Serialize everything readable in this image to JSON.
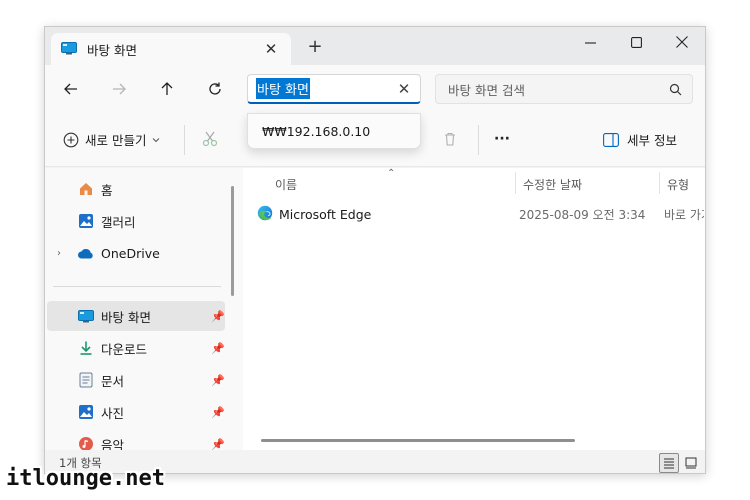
{
  "window": {
    "tab_title": "바탕 화면",
    "new_tab": "+"
  },
  "address": {
    "value": "바탕 화면",
    "suggestion": "₩₩192.168.0.10"
  },
  "search": {
    "placeholder": "바탕 화면 검색"
  },
  "toolbar": {
    "new_label": "새로 만들기",
    "more_label": "···",
    "details_label": "세부 정보"
  },
  "sidebar": {
    "items": [
      {
        "label": "홈",
        "icon": "home-icon"
      },
      {
        "label": "갤러리",
        "icon": "gallery-icon"
      },
      {
        "label": "OneDrive",
        "icon": "cloud-icon"
      },
      {
        "label": "바탕 화면",
        "icon": "desktop-icon",
        "selected": true,
        "pinned": true
      },
      {
        "label": "다운로드",
        "icon": "download-icon",
        "pinned": true
      },
      {
        "label": "문서",
        "icon": "document-icon",
        "pinned": true
      },
      {
        "label": "사진",
        "icon": "pictures-icon",
        "pinned": true
      },
      {
        "label": "음악",
        "icon": "music-icon",
        "pinned": true
      }
    ]
  },
  "list": {
    "columns": [
      "이름",
      "수정한 날짜",
      "유형"
    ],
    "rows": [
      {
        "name": "Microsoft Edge",
        "date": "2025-08-09 오전 3:34",
        "type": "바로 가기"
      }
    ]
  },
  "status": {
    "count": "1개 항목"
  },
  "watermark": "itlounge.net",
  "colors": {
    "accent": "#0078d4",
    "selection_bg": "#e5e5e5"
  }
}
